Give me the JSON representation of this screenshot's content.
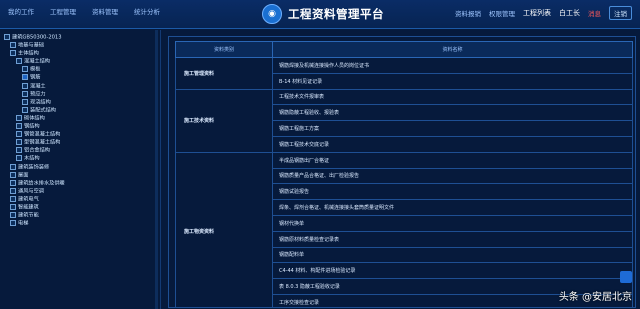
{
  "topnav": {
    "items": [
      "我的工作",
      "工程管理",
      "资料管理",
      "统计分析"
    ],
    "title": "工程资料管理平台",
    "right_items": [
      "资料报销",
      "权限管理",
      "工程列表"
    ],
    "user_name": "白工长",
    "notice": "消息",
    "logout_label": "注销"
  },
  "sidebar": {
    "tree": [
      {
        "label": "建筑GB50300-2013",
        "level": 0
      },
      {
        "label": "地基与基础",
        "level": 1
      },
      {
        "label": "主体结构",
        "level": 1
      },
      {
        "label": "混凝土结构",
        "level": 2
      },
      {
        "label": "模板",
        "level": 3
      },
      {
        "label": "钢筋",
        "level": 3,
        "selected": true
      },
      {
        "label": "混凝土",
        "level": 3
      },
      {
        "label": "预应力",
        "level": 3
      },
      {
        "label": "现浇结构",
        "level": 3
      },
      {
        "label": "装配式结构",
        "level": 3
      },
      {
        "label": "砌体结构",
        "level": 2
      },
      {
        "label": "钢结构",
        "level": 2
      },
      {
        "label": "钢管混凝土结构",
        "level": 2
      },
      {
        "label": "型钢混凝土结构",
        "level": 2
      },
      {
        "label": "铝合金结构",
        "level": 2
      },
      {
        "label": "木结构",
        "level": 2
      },
      {
        "label": "建筑装饰装修",
        "level": 1
      },
      {
        "label": "屋面",
        "level": 1
      },
      {
        "label": "建筑给水排水及供暖",
        "level": 1
      },
      {
        "label": "通风与空调",
        "level": 1
      },
      {
        "label": "建筑电气",
        "level": 1
      },
      {
        "label": "智能建筑",
        "level": 1
      },
      {
        "label": "建筑节能",
        "level": 1
      },
      {
        "label": "电梯",
        "level": 1
      }
    ]
  },
  "table": {
    "headers": [
      "资料类别",
      "资料名称"
    ],
    "groups": [
      {
        "category": "施工管理资料",
        "items": [
          "钢筋焊接及机械连接操作人员的岗位证书",
          "B-14 材料见证记录"
        ]
      },
      {
        "category": "施工技术资料",
        "items": [
          "工程技术文件报审表",
          "钢筋隐蔽工程验收、报验表",
          "钢筋工程施工方案",
          "钢筋工程技术交底记录"
        ]
      },
      {
        "category": "施工物资资料",
        "items": [
          "半成品钢筋出厂合格证",
          "钢筋质量产品合格证、出厂检验报告",
          "钢筋试验报告",
          "焊条、焊剂合格证、机械连接接头套筒质量证明文件",
          "钢材代换单",
          "钢筋原材料质量检查记录表",
          "钢筋配料单",
          "C4-44 材料、构配件进场检验记录",
          "表 8.0.3 隐蔽工程验收记录",
          "工序交接检查记录"
        ]
      }
    ]
  },
  "watermark": "头条 @安居北京"
}
